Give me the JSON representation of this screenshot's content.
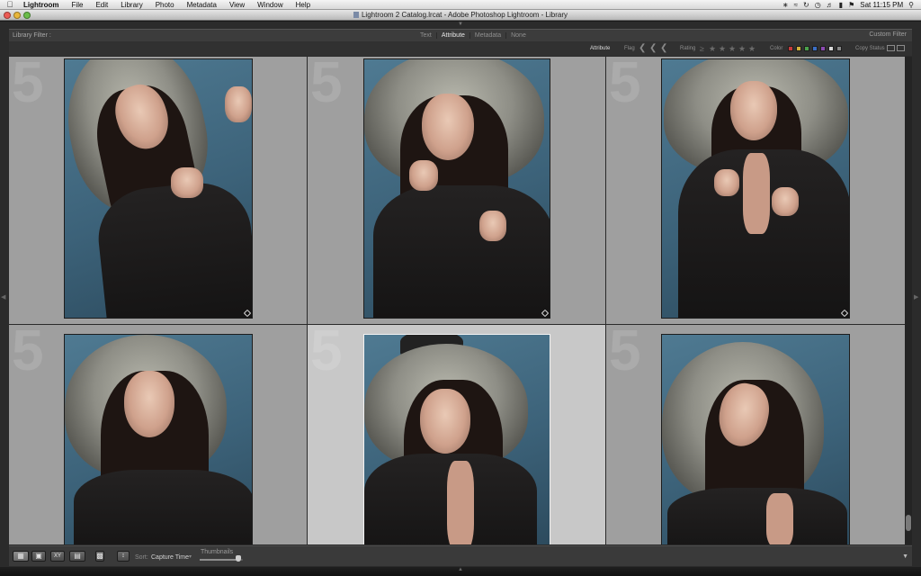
{
  "menubar": {
    "app": "Lightroom",
    "items": [
      "File",
      "Edit",
      "Library",
      "Photo",
      "Metadata",
      "View",
      "Window",
      "Help"
    ],
    "clock": "Sat 11:15 PM",
    "status_icons": [
      "bluetooth-icon",
      "wifi-icon",
      "sync-icon",
      "time-machine-icon",
      "volume-icon",
      "battery-icon",
      "flag-icon",
      "spotlight-icon"
    ]
  },
  "window": {
    "title": "Lightroom 2 Catalog.lrcat - Adobe Photoshop Lightroom - Library"
  },
  "filter": {
    "label": "Library Filter :",
    "tabs": [
      {
        "label": "Text",
        "active": false
      },
      {
        "label": "Attribute",
        "active": true
      },
      {
        "label": "Metadata",
        "active": false
      },
      {
        "label": "None",
        "active": false
      }
    ],
    "preset": "Custom Filter"
  },
  "attribute_bar": {
    "section": "Attribute",
    "flag_label": "Flag",
    "rating_label": "Rating",
    "color_label": "Color",
    "copy_label": "Copy Status",
    "stars": 5,
    "colors": [
      "#c43b3b",
      "#d1b23a",
      "#4aa14a",
      "#3b6ec4",
      "#8b4ab1",
      "#d8d8d8",
      "#888888"
    ]
  },
  "grid": {
    "cells": [
      {
        "number": "5",
        "selected": false
      },
      {
        "number": "5",
        "selected": false
      },
      {
        "number": "5",
        "selected": false
      },
      {
        "number": "5",
        "selected": false
      },
      {
        "number": "5",
        "selected": true
      },
      {
        "number": "5",
        "selected": false
      }
    ]
  },
  "toolbar": {
    "sort_label": "Sort:",
    "sort_value": "Capture Time",
    "thumbnails_label": "Thumbnails",
    "thumbnail_size": 0.9,
    "views": [
      "grid-view-icon",
      "loupe-view-icon",
      "compare-view-icon",
      "survey-view-icon"
    ]
  }
}
